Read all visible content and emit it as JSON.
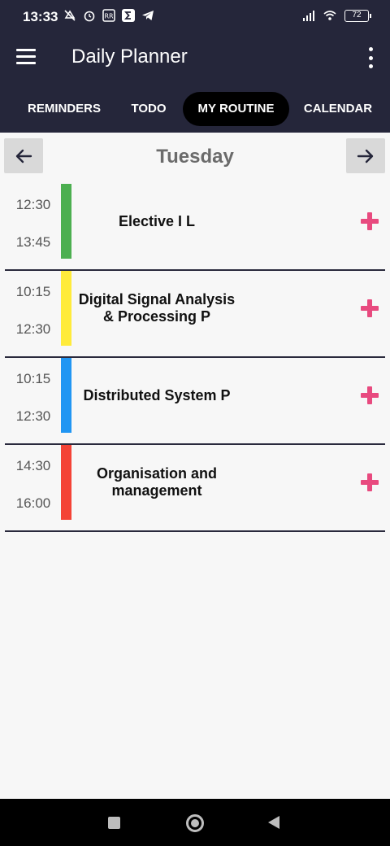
{
  "status": {
    "time": "13:33",
    "battery": "72",
    "icons": [
      "mute-icon",
      "alarm-icon",
      "rr-icon",
      "sigma-icon",
      "telegram-icon",
      "signal-icon",
      "wifi-icon",
      "battery-icon"
    ]
  },
  "app": {
    "title": "Daily Planner"
  },
  "tabs": [
    {
      "label": "REMINDERS"
    },
    {
      "label": "TODO"
    },
    {
      "label": "MY ROUTINE",
      "active": true
    },
    {
      "label": "CALENDAR"
    }
  ],
  "day": {
    "title": "Tuesday"
  },
  "routine": [
    {
      "start": "12:30",
      "end": "13:45",
      "subject": "Elective I L",
      "color": "#4caf50"
    },
    {
      "start": "10:15",
      "end": "12:30",
      "subject": "Digital Signal Analysis & Processing P",
      "color": "#ffeb3b"
    },
    {
      "start": "10:15",
      "end": "12:30",
      "subject": "Distributed System P",
      "color": "#2196f3"
    },
    {
      "start": "14:30",
      "end": "16:00",
      "subject": "Organisation and management",
      "color": "#f44336"
    }
  ],
  "colors": {
    "app_bar": "#25263a",
    "accent_add": "#e84a7f",
    "active_tab": "#000000"
  }
}
